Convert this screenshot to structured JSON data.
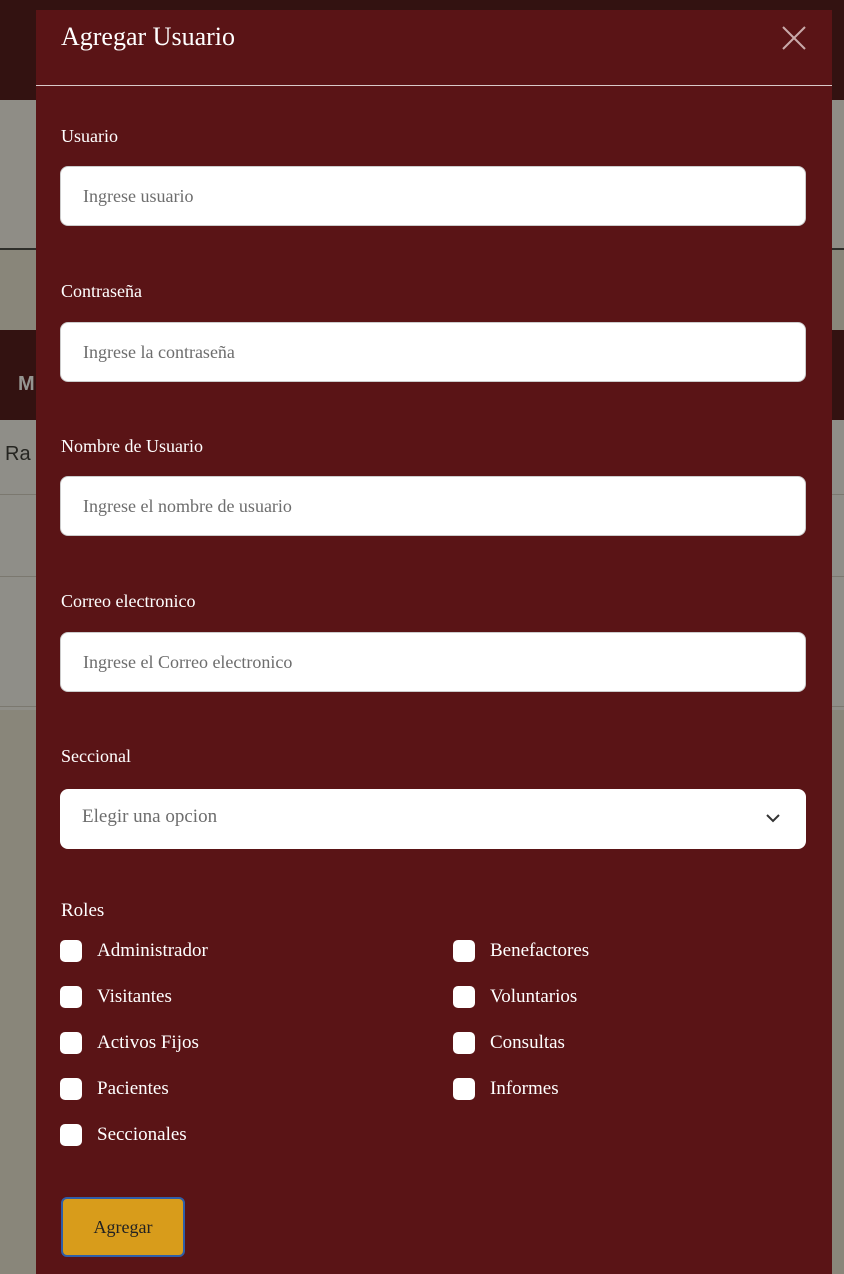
{
  "background": {
    "header_fragment": "M",
    "table_fragment": "Ra"
  },
  "modal": {
    "title": "Agregar Usuario",
    "close_icon": "close-icon",
    "fields": {
      "usuario": {
        "label": "Usuario",
        "placeholder": "Ingrese usuario",
        "value": ""
      },
      "contrasena": {
        "label": "Contraseña",
        "placeholder": "Ingrese la contraseña",
        "value": ""
      },
      "nombre": {
        "label": "Nombre de Usuario",
        "placeholder": "Ingrese el nombre de usuario",
        "value": ""
      },
      "correo": {
        "label": "Correo electronico",
        "placeholder": "Ingrese el Correo electronico",
        "value": ""
      }
    },
    "seccional": {
      "label": "Seccional",
      "selected": "Elegir una opcion",
      "icon": "chevron-down-icon"
    },
    "roles": {
      "label": "Roles",
      "left": [
        "Administrador",
        "Visitantes",
        "Activos Fijos",
        "Pacientes",
        "Seccionales"
      ],
      "right": [
        "Benefactores",
        "Voluntarios",
        "Consultas",
        "Informes"
      ]
    },
    "submit_label": "Agregar"
  },
  "colors": {
    "modal_bg": "#5a1416",
    "button_bg": "#d89c1b",
    "button_border": "#2f5ea8"
  }
}
